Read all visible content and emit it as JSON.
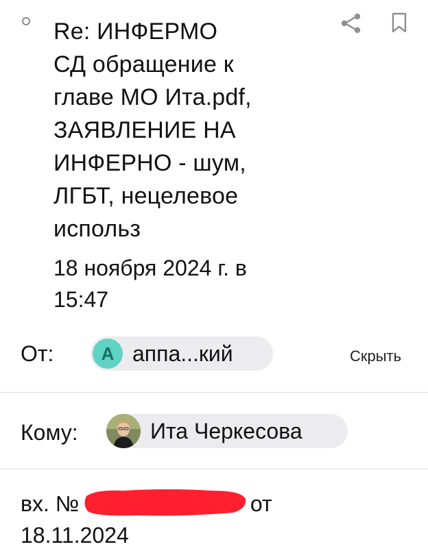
{
  "email": {
    "subject": "Re: ИНФЕРМО\nСД обращение к\nглаве МО Ита.pdf,\nЗАЯВЛЕНИЕ НА\nИНФЕРНО - шум,\nЛГБТ, нецелевое\nиспольз",
    "date": "18 ноября 2024 г. в\n15:47",
    "from": {
      "label": "От:",
      "avatar_initial": "А",
      "name": "аппа...кий",
      "avatar_color": "#5fd3c4"
    },
    "hide_label": "Скрыть",
    "to": {
      "label": "Кому:",
      "name": "Ита Черкесова"
    },
    "body": {
      "prefix": "вх. №",
      "suffix": "от",
      "date_line": "18.11.2024",
      "redaction_color": "#ff1f2f"
    },
    "icons": {
      "unread": "unread-dot-icon",
      "share": "share-icon",
      "bookmark": "bookmark-icon"
    }
  }
}
